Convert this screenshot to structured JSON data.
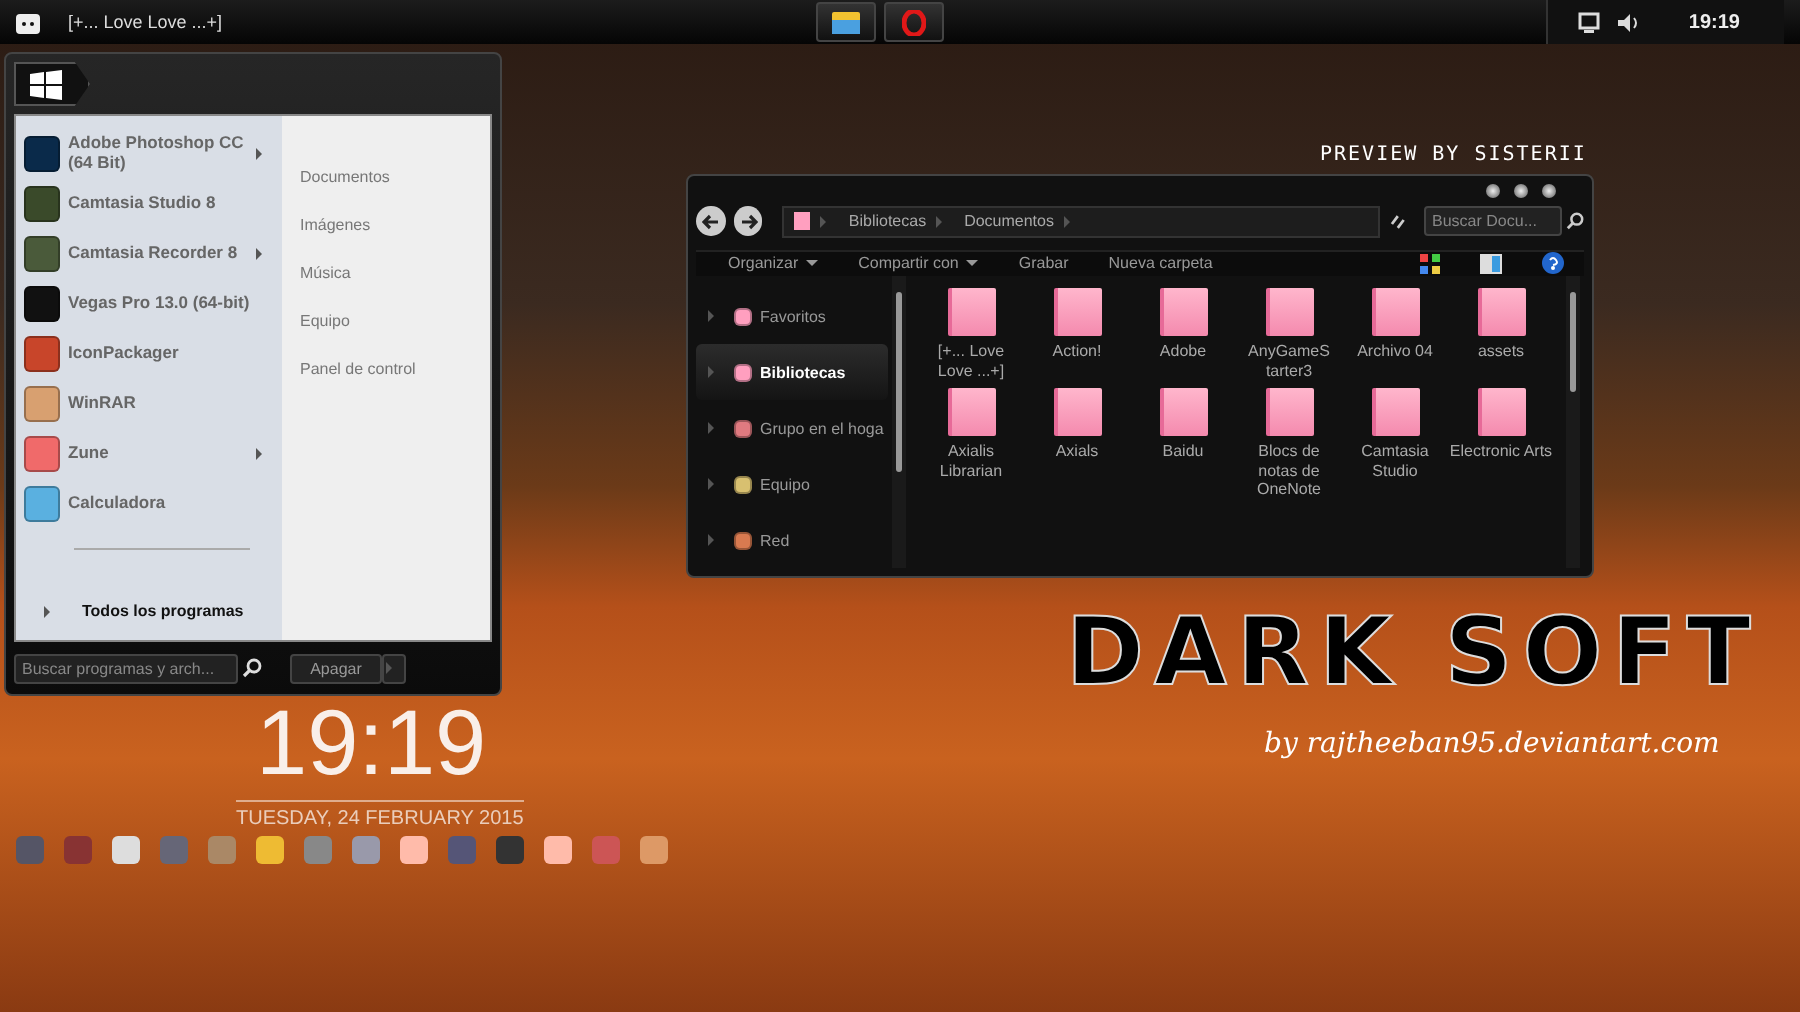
{
  "taskbar": {
    "window_title": "[+... Love Love ...+]",
    "clock": "19:19"
  },
  "start_menu": {
    "programs": [
      {
        "name": "Adobe Photoshop CC (64 Bit)",
        "kind": "photoshop",
        "submenu": true
      },
      {
        "name": "Camtasia Studio 8",
        "kind": "camtasia",
        "submenu": false
      },
      {
        "name": "Camtasia Recorder 8",
        "kind": "recorder",
        "submenu": true
      },
      {
        "name": "Vegas Pro 13.0 (64-bit)",
        "kind": "vegas",
        "submenu": false
      },
      {
        "name": "IconPackager",
        "kind": "iconpackager",
        "submenu": false
      },
      {
        "name": "WinRAR",
        "kind": "winrar",
        "submenu": false
      },
      {
        "name": "Zune",
        "kind": "zune",
        "submenu": true
      },
      {
        "name": "Calculadora",
        "kind": "calculator",
        "submenu": false
      }
    ],
    "all_programs": "Todos los programas",
    "places": [
      "Documentos",
      "Imágenes",
      "Música",
      "Equipo",
      "Panel de control"
    ],
    "search": {
      "placeholder": "Buscar programas y arch..."
    },
    "shutdown": "Apagar"
  },
  "explorer": {
    "breadcrumb": [
      "Bibliotecas",
      "Documentos"
    ],
    "search": {
      "placeholder": "Buscar Docu..."
    },
    "toolbar": [
      {
        "label": "Organizar",
        "dropdown": true
      },
      {
        "label": "Compartir con",
        "dropdown": true
      },
      {
        "label": "Grabar",
        "dropdown": false
      },
      {
        "label": "Nueva carpeta",
        "dropdown": false
      }
    ],
    "nav": [
      {
        "label": "Favoritos",
        "kind": "favorites",
        "selected": false
      },
      {
        "label": "Bibliotecas",
        "kind": "libraries",
        "selected": true
      },
      {
        "label": "Grupo en el hoga",
        "kind": "homegroup",
        "selected": false
      },
      {
        "label": "Equipo",
        "kind": "computer",
        "selected": false
      },
      {
        "label": "Red",
        "kind": "network",
        "selected": false
      }
    ],
    "folders": [
      "[+... Love Love ...+]",
      "Action!",
      "Adobe",
      "AnyGameS tarter3",
      "Archivo 04",
      "assets",
      "Axialis Librarian",
      "Axials",
      "Baidu",
      "Blocs de notas de OneNote",
      "Camtasia Studio",
      "Electronic Arts"
    ]
  },
  "desktop": {
    "credit": "PREVIEW BY SISTERII",
    "clock": "19:19",
    "date": "TUESDAY, 24 FEBRUARY 2015",
    "title": "DARK SOFT",
    "subtitle": "by rajtheeban95.deviantart.com"
  }
}
